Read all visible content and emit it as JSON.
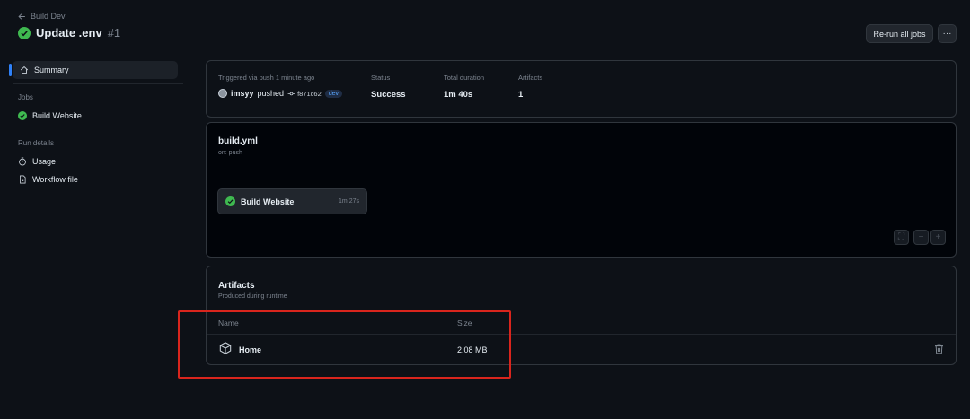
{
  "header": {
    "back_label": "Build Dev",
    "title": "Update .env",
    "run_number": "#1",
    "rerun_label": "Re-run all jobs",
    "more_label": "···"
  },
  "sidebar": {
    "summary_label": "Summary",
    "jobs_section": "Jobs",
    "job_item": "Build Website",
    "run_details_section": "Run details",
    "usage_label": "Usage",
    "workflow_file_label": "Workflow file"
  },
  "summary": {
    "trigger_label": "Triggered via push 1 minute ago",
    "actor": "imsyy",
    "action": "pushed",
    "commit": "f871c62",
    "branch": "dev",
    "status_label": "Status",
    "status_value": "Success",
    "duration_label": "Total duration",
    "duration_value": "1m 40s",
    "artifacts_label": "Artifacts",
    "artifacts_value": "1"
  },
  "graph": {
    "workflow_name": "build.yml",
    "workflow_trigger": "on: push",
    "job_name": "Build Website",
    "job_duration": "1m 27s",
    "fullscreen_label": "⛶",
    "zoom_out_label": "−",
    "zoom_in_label": "+"
  },
  "artifacts": {
    "title": "Artifacts",
    "subtitle": "Produced during runtime",
    "col_name": "Name",
    "col_size": "Size",
    "rows": [
      {
        "name": "Home",
        "size": "2.08 MB"
      }
    ]
  },
  "colors": {
    "success": "#3fb950",
    "accent": "#2f81f7",
    "highlight": "#d9251d"
  },
  "icons": {
    "back": "arrow-left-icon",
    "status": "check-circle-icon",
    "summary": "home-icon",
    "usage": "stopwatch-icon",
    "workflow": "file-icon",
    "artifact": "package-icon",
    "delete": "trash-icon"
  }
}
